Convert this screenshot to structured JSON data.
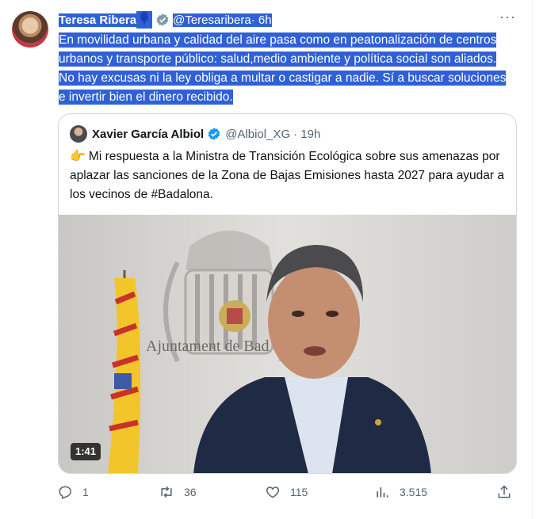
{
  "tweet": {
    "author_name": "Teresa Ribera",
    "author_handle": "@Teresaribera",
    "time": "· 6h",
    "more_label": "···",
    "text": "En movilidad urbana y calidad del aire pasa como en peatonalización de centros urbanos y transporte público: salud,medio ambiente y política social son aliados. No hay excusas ni la ley obliga a multar o castigar a nadie. Sí a buscar soluciones e invertir bien el dinero recibido.",
    "highlight_color": "#2f61d6"
  },
  "quote": {
    "author_name": "Xavier García Albiol",
    "author_handle": "@Albiol_XG",
    "time": "· 19h",
    "emoji": "👉",
    "text": "Mi respuesta a la Ministra de Transición Ecológica sobre sus amenazas por aplazar las sanciones de la Zona de Bajas Emisiones hasta 2027 para ayudar a los vecinos de #Badalona.",
    "video": {
      "duration": "1:41",
      "wall_text": "Ajuntament de Bad"
    }
  },
  "actions": {
    "replies": "1",
    "retweets": "36",
    "likes": "115",
    "views": "3.515"
  },
  "icons": {
    "reply": "reply-icon",
    "retweet": "retweet-icon",
    "like": "heart-icon",
    "views": "views-icon",
    "share": "share-icon",
    "verified": "verified-badge-icon",
    "pin": "blue-pin-icon"
  },
  "colors": {
    "verified_badge": "#829aab",
    "secondary_text": "#536471",
    "border": "#cfd9de"
  }
}
